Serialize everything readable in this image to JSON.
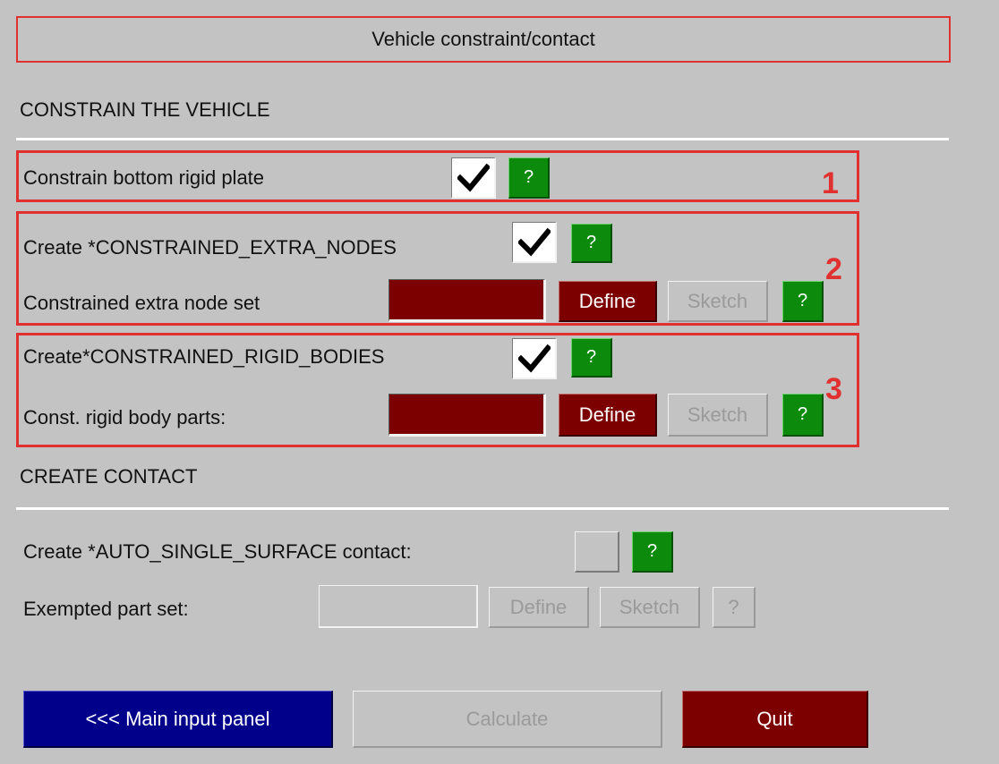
{
  "panel": {
    "title": "Vehicle constraint/contact"
  },
  "constrain_section": {
    "heading": "CONSTRAIN THE VEHICLE",
    "block1": {
      "number": "1",
      "constrain_bottom_label": "Constrain bottom rigid plate",
      "checked": true,
      "help_label": "?"
    },
    "block2": {
      "number": "2",
      "create_extra_nodes_label": "Create *CONSTRAINED_EXTRA_NODES",
      "checked": true,
      "help_label": "?",
      "node_set_label": "Constrained extra node set",
      "node_set_value": "",
      "define_label": "Define",
      "sketch_label": "Sketch",
      "help2_label": "?"
    },
    "block3": {
      "number": "3",
      "create_rigid_bodies_label": "Create*CONSTRAINED_RIGID_BODIES",
      "checked": true,
      "help_label": "?",
      "parts_label": "Const. rigid body parts:",
      "parts_value": "",
      "define_label": "Define",
      "sketch_label": "Sketch",
      "help2_label": "?"
    }
  },
  "contact_section": {
    "heading": "CREATE CONTACT",
    "auto_single_surface_label": "Create *AUTO_SINGLE_SURFACE contact:",
    "auto_checked": false,
    "help_label": "?",
    "exempted_label": "Exempted part set:",
    "exempted_value": "",
    "define_label": "Define",
    "sketch_label": "Sketch",
    "help2_label": "?"
  },
  "footer": {
    "main_input_label": "<<< Main input panel",
    "calculate_label": "Calculate",
    "quit_label": "Quit"
  },
  "colors": {
    "background": "#c3c3c3",
    "callout_red": "#e03030",
    "help_green": "#0b8a0b",
    "define_maroon": "#7d0000",
    "main_blue": "#00008b"
  }
}
